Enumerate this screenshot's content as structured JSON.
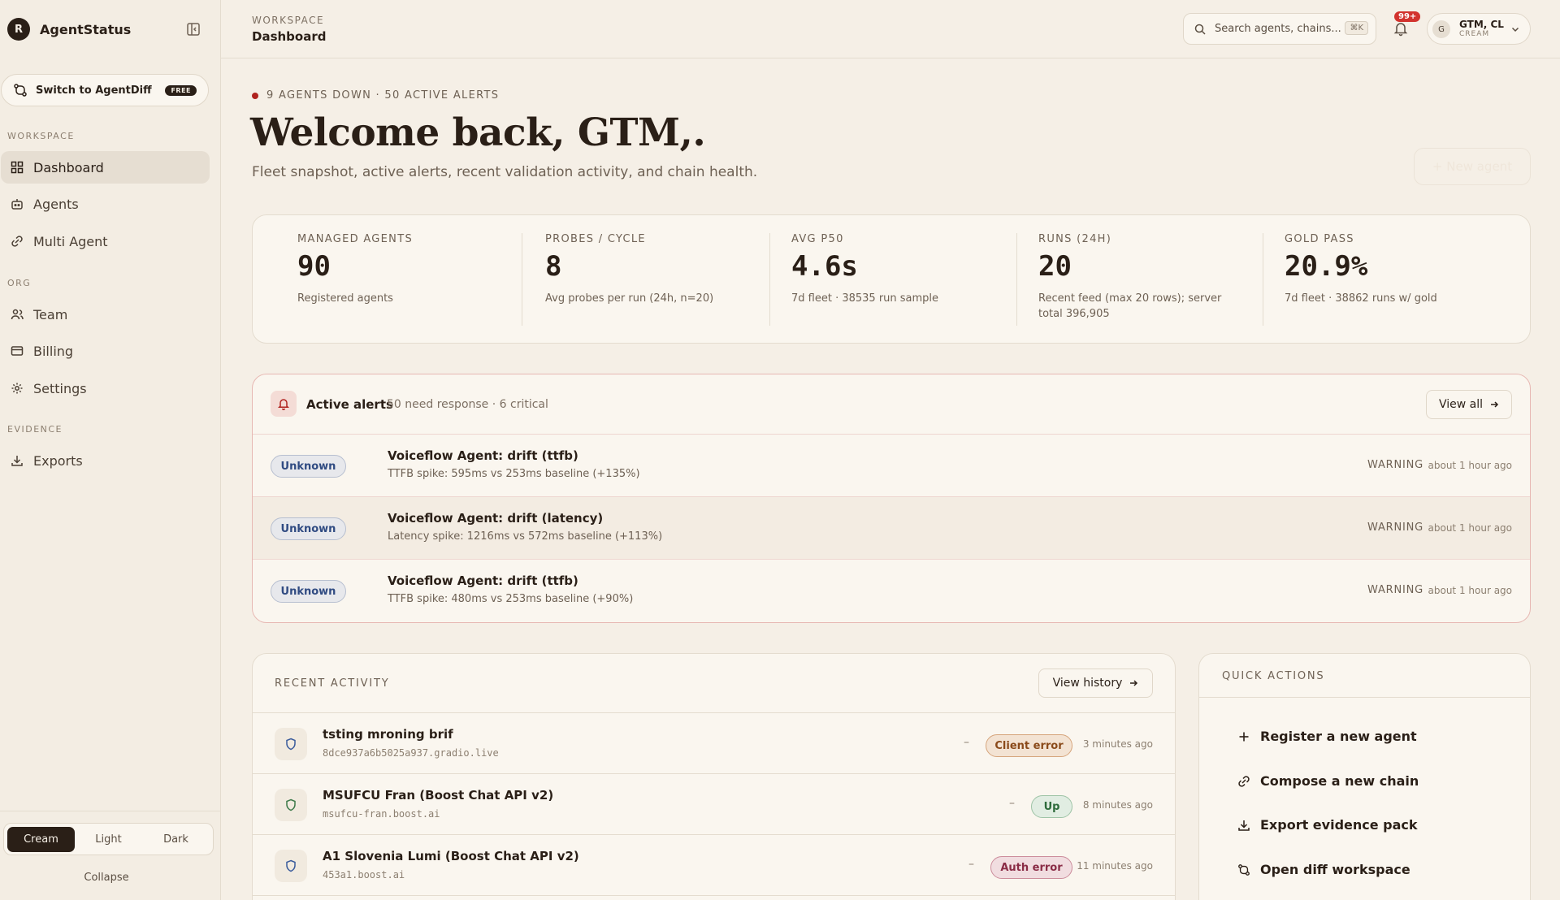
{
  "brand": {
    "logo_letter": "R",
    "name": "AgentStatus"
  },
  "switch": {
    "label": "Switch to AgentDiff",
    "badge": "FREE"
  },
  "nav": {
    "sections": {
      "workspace": "WORKSPACE",
      "org": "ORG",
      "evidence": "EVIDENCE"
    },
    "items": [
      {
        "label": "Dashboard",
        "icon": "grid-icon",
        "active": true
      },
      {
        "label": "Agents",
        "icon": "bot-icon"
      },
      {
        "label": "Multi Agent",
        "icon": "link-icon"
      },
      {
        "label": "Team",
        "icon": "users-icon"
      },
      {
        "label": "Billing",
        "icon": "card-icon"
      },
      {
        "label": "Settings",
        "icon": "gear-icon"
      },
      {
        "label": "Exports",
        "icon": "download-icon"
      }
    ]
  },
  "theme": {
    "options": [
      "Cream",
      "Light",
      "Dark"
    ],
    "selected": "Cream"
  },
  "collapse_label": "Collapse",
  "header": {
    "crumb_top": "WORKSPACE",
    "crumb_title": "Dashboard",
    "search_placeholder": "Search agents, chains...",
    "search_kbd": "⌘K",
    "bell_badge": "99+",
    "user_initial": "G",
    "user_name": "GTM, CL",
    "user_sub": "CREAM"
  },
  "status_line": "9 AGENTS DOWN · 50 ACTIVE ALERTS",
  "welcome": "Welcome back, GTM,.",
  "subtitle": "Fleet snapshot, active alerts, recent validation activity, and chain health.",
  "new_agent_label": "+ New agent",
  "stats": [
    {
      "label": "MANAGED AGENTS",
      "value": "90",
      "note": "Registered agents"
    },
    {
      "label": "PROBES / CYCLE",
      "value": "8",
      "note": "Avg probes per run (24h, n=20)"
    },
    {
      "label": "AVG P50",
      "value": "4.6s",
      "note": "7d fleet · 38535 run sample"
    },
    {
      "label": "RUNS (24H)",
      "value": "20",
      "note": "Recent feed (max 20 rows); server total 396,905"
    },
    {
      "label": "GOLD PASS",
      "value": "20.9%",
      "note": "7d fleet · 38862 runs w/ gold"
    }
  ],
  "alerts": {
    "title": "Active alerts",
    "subtitle": "50 need response · 6 critical",
    "view_all": "View all",
    "rows": [
      {
        "status": "Unknown",
        "title": "Voiceflow Agent: drift (ttfb)",
        "desc": "TTFB spike: 595ms vs 253ms baseline (+135%)",
        "severity": "WARNING",
        "time": "about 1 hour ago"
      },
      {
        "status": "Unknown",
        "title": "Voiceflow Agent: drift (latency)",
        "desc": "Latency spike: 1216ms vs 572ms baseline (+113%)",
        "severity": "WARNING",
        "time": "about 1 hour ago"
      },
      {
        "status": "Unknown",
        "title": "Voiceflow Agent: drift (ttfb)",
        "desc": "TTFB spike: 480ms vs 253ms baseline (+90%)",
        "severity": "WARNING",
        "time": "about 1 hour ago"
      }
    ]
  },
  "activity": {
    "label": "RECENT ACTIVITY",
    "view_history": "View history",
    "rows": [
      {
        "title": "tsting mroning brif",
        "host": "8dce937a6b5025a937.gradio.live",
        "dash": "–",
        "status": "Client error",
        "time": "3 minutes ago",
        "shield_color": "#3b5c9c"
      },
      {
        "title": "MSUFCU Fran (Boost Chat API v2)",
        "host": "msufcu-fran.boost.ai",
        "dash": "–",
        "status": "Up",
        "time": "8 minutes ago",
        "shield_color": "#3d7a4a"
      },
      {
        "title": "A1 Slovenia Lumi (Boost Chat API v2)",
        "host": "453a1.boost.ai",
        "dash": "–",
        "status": "Auth error",
        "time": "11 minutes ago",
        "shield_color": "#3b5c9c"
      }
    ]
  },
  "quick": {
    "label": "QUICK ACTIONS",
    "items": [
      {
        "label": "Register a new agent",
        "icon": "plus-icon"
      },
      {
        "label": "Compose a new chain",
        "icon": "link-icon"
      },
      {
        "label": "Export evidence pack",
        "icon": "download-icon"
      },
      {
        "label": "Open diff workspace",
        "icon": "diff-icon"
      }
    ]
  }
}
